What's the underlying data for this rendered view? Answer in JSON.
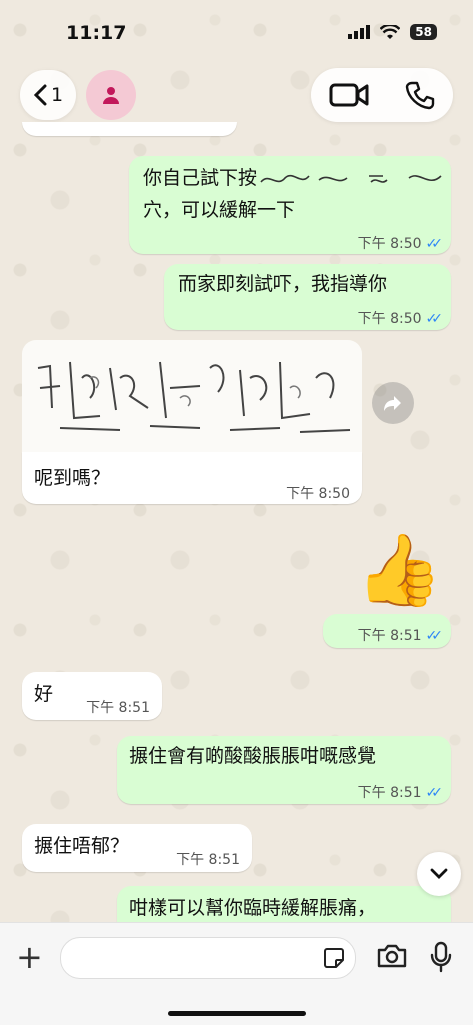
{
  "status_bar": {
    "time": "11:17",
    "battery": "58"
  },
  "header": {
    "back_count": "1",
    "contact_name": ""
  },
  "messages": [
    {
      "text": "你自己試下按",
      "line2": "穴，可以緩解一下",
      "time": "下午 8:50"
    },
    {
      "text": "而家即刻試吓，我指導你",
      "time": "下午 8:50"
    },
    {
      "text": "呢到嗎？",
      "time": "下午 8:50"
    },
    {
      "emoji": "👍",
      "time": "下午 8:51"
    },
    {
      "text": "好",
      "time": "下午 8:51"
    },
    {
      "text": "搌住會有啲酸酸脹脹咁嘅感覺",
      "time": "下午 8:51"
    },
    {
      "text": "搌住唔郁？",
      "time": "下午 8:51"
    },
    {
      "text": "咁樣可以幫你臨時緩解脹痛，"
    }
  ],
  "colors": {
    "outgoing": "#d9fdd3",
    "incoming": "#ffffff",
    "read_ticks": "#2f86f6"
  }
}
